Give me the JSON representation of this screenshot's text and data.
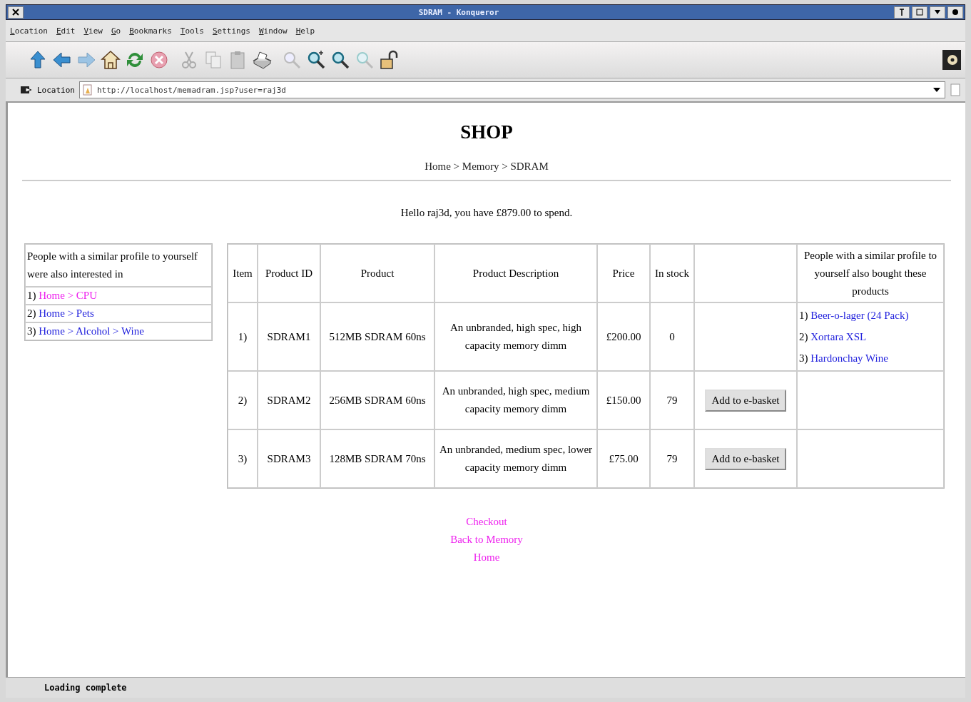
{
  "window": {
    "title": "SDRAM - Konqueror"
  },
  "menu": [
    "Location",
    "Edit",
    "View",
    "Go",
    "Bookmarks",
    "Tools",
    "Settings",
    "Window",
    "Help"
  ],
  "location_bar": {
    "label": "Location",
    "url": "http://localhost/memadram.jsp?user=raj3d"
  },
  "page": {
    "title": "SHOP",
    "breadcrumb": "Home > Memory > SDRAM",
    "greeting": "Hello raj3d, you have £879.00 to spend.",
    "side_panel": {
      "heading": "People with a similar profile to yourself were also interested in",
      "items": [
        {
          "number": "1)",
          "link": "Home > CPU",
          "visited": true
        },
        {
          "number": "2)",
          "link": "Home > Pets",
          "visited": false
        },
        {
          "number": "3)",
          "link": "Home > Alcohol > Wine",
          "visited": false
        }
      ]
    },
    "table": {
      "columns": [
        "Item",
        "Product ID",
        "Product",
        "Product Description",
        "Price",
        "In stock",
        "",
        "People with a similar profile to yourself also bought these products"
      ],
      "rows": [
        {
          "item": "1)",
          "product_id": "SDRAM1",
          "product": "512MB SDRAM 60ns",
          "description": "An unbranded, high spec, high capacity memory dimm",
          "price": "£200.00",
          "stock": "0",
          "button": null,
          "also_bought": [
            {
              "number": "1)",
              "link": "Beer-o-lager (24 Pack)",
              "visited": false
            },
            {
              "number": "2)",
              "link": "Xortara XSL",
              "visited": false
            },
            {
              "number": "3)",
              "link": "Hardonchay Wine",
              "visited": false
            }
          ]
        },
        {
          "item": "2)",
          "product_id": "SDRAM2",
          "product": "256MB SDRAM 60ns",
          "description": "An unbranded, high spec, medium capacity memory dimm",
          "price": "£150.00",
          "stock": "79",
          "button": "Add to e-basket",
          "also_bought": []
        },
        {
          "item": "3)",
          "product_id": "SDRAM3",
          "product": "128MB SDRAM 70ns",
          "description": "An unbranded, medium spec, lower capacity memory dimm",
          "price": "£75.00",
          "stock": "79",
          "button": "Add to e-basket",
          "also_bought": []
        }
      ]
    },
    "footer_links": [
      {
        "label": "Checkout",
        "visited": true
      },
      {
        "label": "Back to Memory",
        "visited": true
      },
      {
        "label": "Home",
        "visited": true
      }
    ]
  },
  "status_bar": "Loading complete"
}
